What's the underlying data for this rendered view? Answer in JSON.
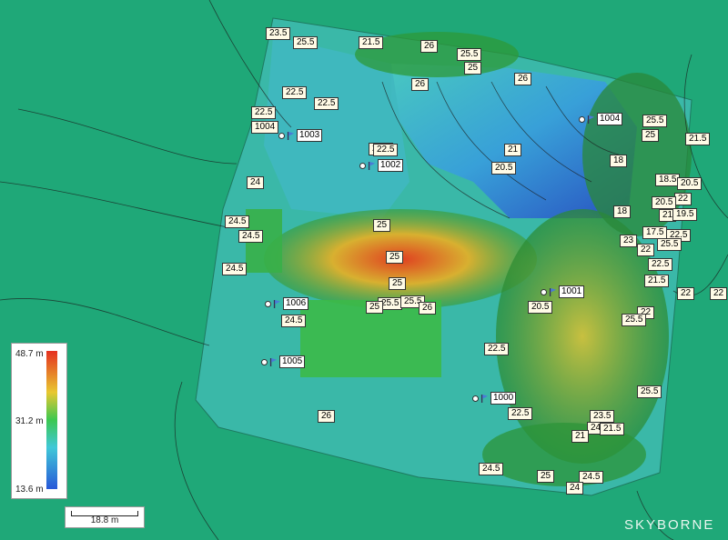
{
  "contour_labels": [
    "23.5",
    "25.5",
    "21.5",
    "26",
    "25.5",
    "25",
    "26",
    "26",
    "22.5",
    "22.5",
    "22.5",
    "23.5",
    "1004",
    "25.5",
    "25",
    "21.5",
    "22.5",
    "18",
    "18.5",
    "20.5",
    "22",
    "20.5",
    "21",
    "19.5",
    "17.5",
    "22.5",
    "23",
    "22",
    "25.5",
    "22.5",
    "21.5",
    "22",
    "22",
    "25.5",
    "20.5",
    "25.5",
    "25.5",
    "26",
    "25",
    "24.5",
    "22.5",
    "22.5",
    "25.5",
    "23.5",
    "24",
    "21.5",
    "21",
    "24.5",
    "24.5",
    "25",
    "24",
    "26",
    "24",
    "24.5",
    "24.5",
    "24.5",
    "25",
    "25",
    "25",
    "21",
    "20.5",
    "18",
    "22"
  ],
  "markers": [
    {
      "id": "1003"
    },
    {
      "id": "1002"
    },
    {
      "id": "1004"
    },
    {
      "id": "1001"
    },
    {
      "id": "1006"
    },
    {
      "id": "1005"
    },
    {
      "id": "1000"
    }
  ],
  "legend": {
    "max": "48.7 m",
    "mid": "31.2 m",
    "min": "13.6 m"
  },
  "scale_bar": "18.8 m",
  "brand": "SKYBORNE",
  "colors": {
    "background": "#1fa878",
    "high": "#e53020",
    "mid": "#3cc850",
    "low": "#2858d8"
  }
}
